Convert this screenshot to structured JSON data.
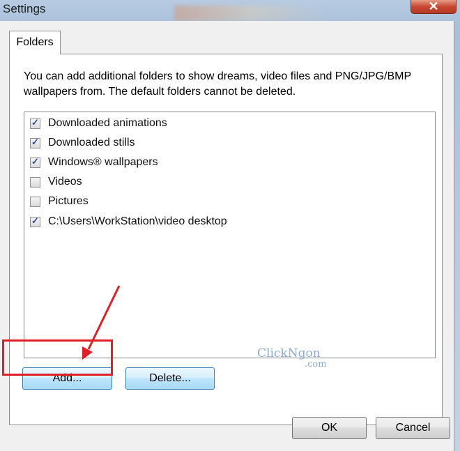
{
  "window": {
    "title": "Settings",
    "close_glyph": "✕"
  },
  "tabs": [
    {
      "label": "Folders"
    }
  ],
  "description": "You can add additional folders to show dreams, video files and PNG/JPG/BMP wallpapers from.  The default folders cannot be deleted.",
  "folders": [
    {
      "label": "Downloaded animations",
      "checked": true
    },
    {
      "label": "Downloaded stills",
      "checked": true
    },
    {
      "label": "Windows® wallpapers",
      "checked": true
    },
    {
      "label": "Videos",
      "checked": false
    },
    {
      "label": "Pictures",
      "checked": false
    },
    {
      "label": "C:\\Users\\WorkStation\\video desktop",
      "checked": true
    }
  ],
  "buttons": {
    "add": "Add...",
    "delete": "Delete...",
    "ok": "OK",
    "cancel": "Cancel"
  },
  "watermark": {
    "main": "ClickNgon",
    "sub": ".com"
  },
  "annotation": {
    "arrow_color": "#e01f26",
    "highlight_color": "#e01f26"
  }
}
